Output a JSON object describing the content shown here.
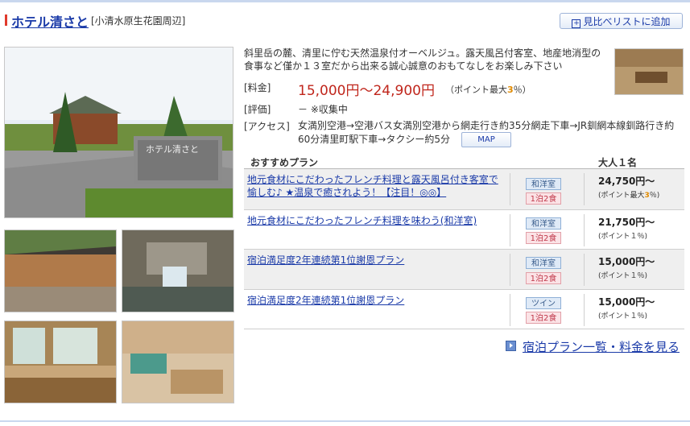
{
  "hotel": {
    "name": "ホテル清さと",
    "area": "[小清水原生花園周辺]",
    "compare_label": "見比べリストに追加",
    "description": "斜里岳の麓、清里に佇む天然温泉付オーベルジュ。露天風呂付客室、地産地消型の食事など僅か１３室だから出来る誠心誠意のおもてなしをお楽しみ下さい"
  },
  "info": {
    "price_label": "[料金]",
    "price_value": "15,000円～24,900円",
    "price_note_pre": "（ポイント最大",
    "price_note_rate": "3",
    "price_note_post": "％）",
    "rating_label": "[評価]",
    "rating_value": "－ ※収集中",
    "access_label": "[アクセス]",
    "access_value": "女満別空港→空港バス女満別空港から網走行き約35分網走下車→JR釧網本線釧路行き約60分清里町駅下車→タクシー約5分",
    "map_label": "MAP"
  },
  "plans_table": {
    "col_plan": "おすすめプラン",
    "col_price": "大人１名",
    "rows": [
      {
        "name": "地元食材にこだわったフレンチ料理と露天風呂付き客室で愉しむ♪ ★温泉で癒されよう！【注目！◎◎】",
        "room": "和洋室",
        "meal": "1泊2食",
        "price": "24,750円～",
        "points": "(ポイント最大",
        "points_rate": "3",
        "points_post": "％)"
      },
      {
        "name": "地元食材にこだわったフレンチ料理を味わう(和洋室)",
        "room": "和洋室",
        "meal": "1泊2食",
        "price": "21,750円～",
        "points": "(ポイント１％)",
        "points_rate": "",
        "points_post": ""
      },
      {
        "name": "宿泊満足度2年連続第1位謝恩プラン",
        "room": "和洋室",
        "meal": "1泊2食",
        "price": "15,000円～",
        "points": "(ポイント１％)",
        "points_rate": "",
        "points_post": ""
      },
      {
        "name": "宿泊満足度2年連続第1位謝恩プラン",
        "room": "ツイン",
        "meal": "1泊2食",
        "price": "15,000円～",
        "points": "(ポイント１％)",
        "points_rate": "",
        "points_post": ""
      }
    ]
  },
  "more_link": "宿泊プラン一覧・料金を見る",
  "colors": {
    "accent": "#1a3aa8",
    "price": "#c0261c",
    "point": "#e08a00"
  }
}
